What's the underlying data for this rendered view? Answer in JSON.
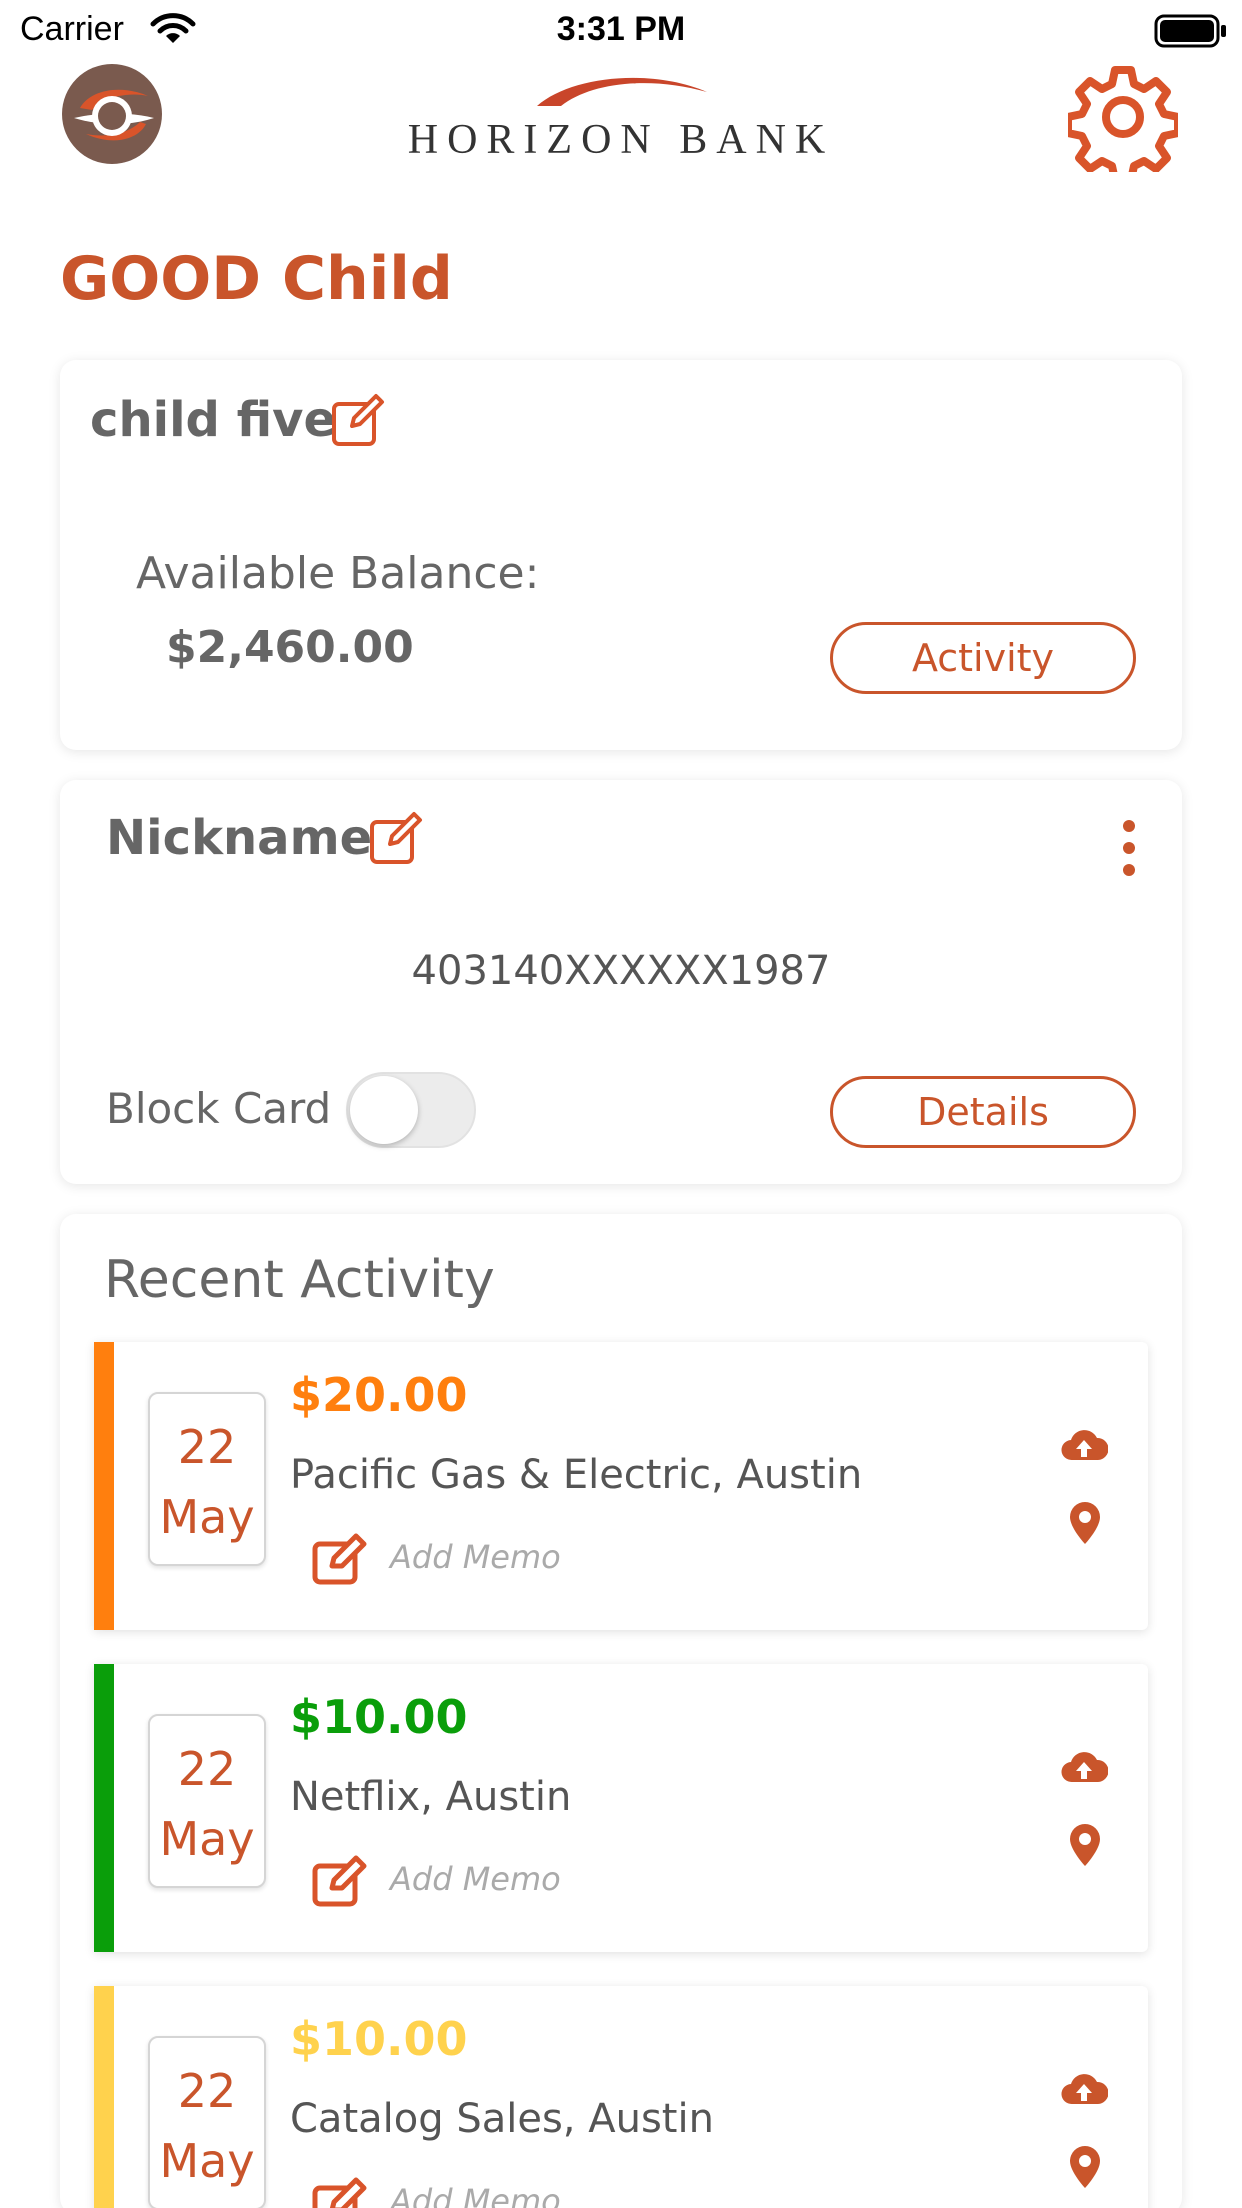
{
  "status_bar": {
    "carrier": "Carrier",
    "time": "3:31 PM"
  },
  "header": {
    "brand_name": "HORIZON BANK",
    "settings_icon": "gear-icon",
    "logo_icon": "horizon-logo-icon"
  },
  "page_title": "GOOD Child",
  "account": {
    "name": "child five",
    "available_balance_label": "Available Balance:",
    "available_balance": "$2,460.00",
    "activity_button": "Activity"
  },
  "card": {
    "nickname": "Nickname",
    "card_number": "403140XXXXXX1987",
    "block_label": "Block Card",
    "block_enabled": false,
    "details_button": "Details"
  },
  "recent_activity": {
    "title": "Recent Activity",
    "transactions": [
      {
        "day": "22",
        "month": "May",
        "amount": "$20.00",
        "merchant": "Pacific Gas & Electric, Austin",
        "memo_placeholder": "Add Memo",
        "color": "#ff7f0e"
      },
      {
        "day": "22",
        "month": "May",
        "amount": "$10.00",
        "merchant": "Netflix, Austin",
        "memo_placeholder": "Add Memo",
        "color": "#0a9e0a"
      },
      {
        "day": "22",
        "month": "May",
        "amount": "$10.00",
        "merchant": "Catalog Sales, Austin",
        "memo_placeholder": "Add Memo",
        "color": "#ffd24d"
      }
    ]
  },
  "colors": {
    "accent": "#c9552b",
    "orange": "#ff7f0e",
    "green": "#0a9e0a",
    "yellow": "#ffd24d"
  }
}
